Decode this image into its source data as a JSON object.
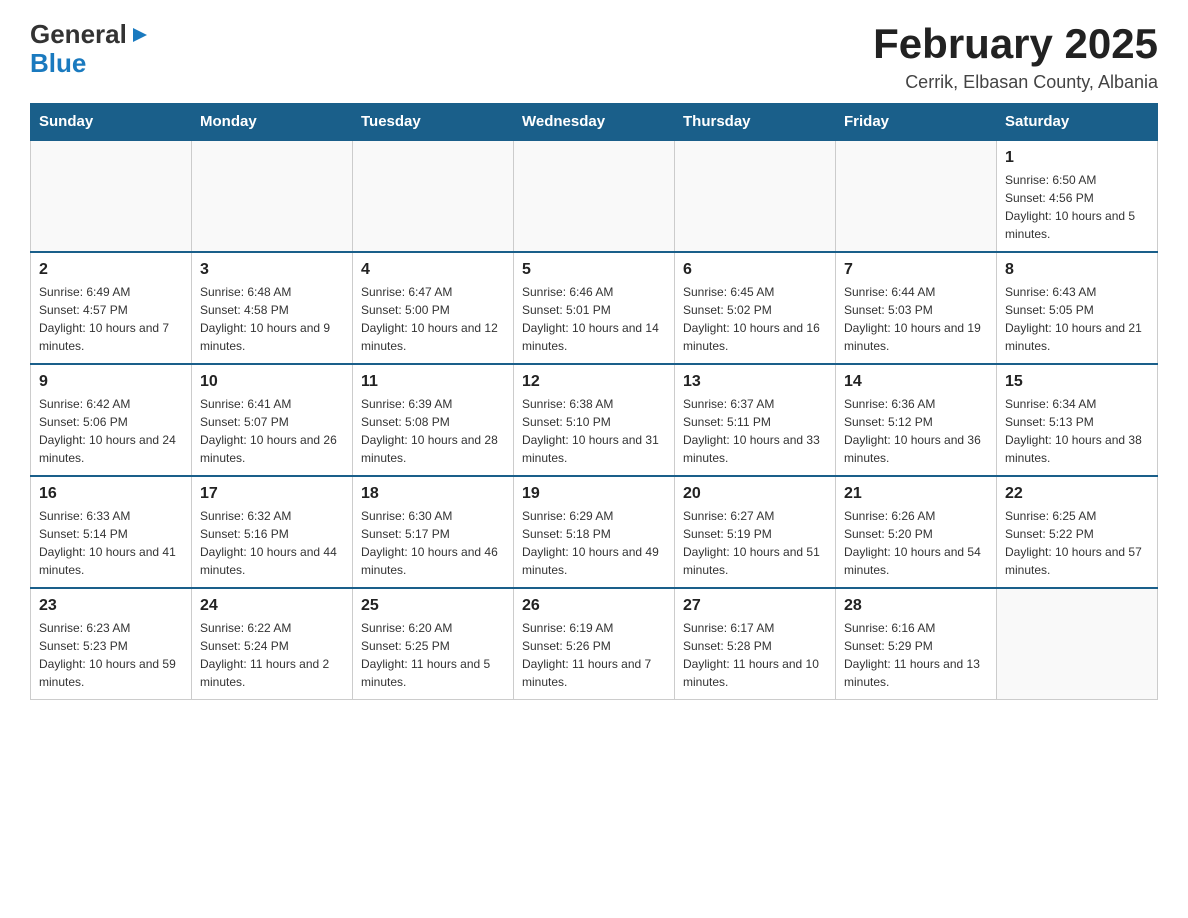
{
  "logo": {
    "general": "General",
    "blue": "Blue",
    "arrow": "▶"
  },
  "title": "February 2025",
  "subtitle": "Cerrik, Elbasan County, Albania",
  "days_of_week": [
    "Sunday",
    "Monday",
    "Tuesday",
    "Wednesday",
    "Thursday",
    "Friday",
    "Saturday"
  ],
  "weeks": [
    [
      {
        "day": "",
        "info": ""
      },
      {
        "day": "",
        "info": ""
      },
      {
        "day": "",
        "info": ""
      },
      {
        "day": "",
        "info": ""
      },
      {
        "day": "",
        "info": ""
      },
      {
        "day": "",
        "info": ""
      },
      {
        "day": "1",
        "info": "Sunrise: 6:50 AM\nSunset: 4:56 PM\nDaylight: 10 hours and 5 minutes."
      }
    ],
    [
      {
        "day": "2",
        "info": "Sunrise: 6:49 AM\nSunset: 4:57 PM\nDaylight: 10 hours and 7 minutes."
      },
      {
        "day": "3",
        "info": "Sunrise: 6:48 AM\nSunset: 4:58 PM\nDaylight: 10 hours and 9 minutes."
      },
      {
        "day": "4",
        "info": "Sunrise: 6:47 AM\nSunset: 5:00 PM\nDaylight: 10 hours and 12 minutes."
      },
      {
        "day": "5",
        "info": "Sunrise: 6:46 AM\nSunset: 5:01 PM\nDaylight: 10 hours and 14 minutes."
      },
      {
        "day": "6",
        "info": "Sunrise: 6:45 AM\nSunset: 5:02 PM\nDaylight: 10 hours and 16 minutes."
      },
      {
        "day": "7",
        "info": "Sunrise: 6:44 AM\nSunset: 5:03 PM\nDaylight: 10 hours and 19 minutes."
      },
      {
        "day": "8",
        "info": "Sunrise: 6:43 AM\nSunset: 5:05 PM\nDaylight: 10 hours and 21 minutes."
      }
    ],
    [
      {
        "day": "9",
        "info": "Sunrise: 6:42 AM\nSunset: 5:06 PM\nDaylight: 10 hours and 24 minutes."
      },
      {
        "day": "10",
        "info": "Sunrise: 6:41 AM\nSunset: 5:07 PM\nDaylight: 10 hours and 26 minutes."
      },
      {
        "day": "11",
        "info": "Sunrise: 6:39 AM\nSunset: 5:08 PM\nDaylight: 10 hours and 28 minutes."
      },
      {
        "day": "12",
        "info": "Sunrise: 6:38 AM\nSunset: 5:10 PM\nDaylight: 10 hours and 31 minutes."
      },
      {
        "day": "13",
        "info": "Sunrise: 6:37 AM\nSunset: 5:11 PM\nDaylight: 10 hours and 33 minutes."
      },
      {
        "day": "14",
        "info": "Sunrise: 6:36 AM\nSunset: 5:12 PM\nDaylight: 10 hours and 36 minutes."
      },
      {
        "day": "15",
        "info": "Sunrise: 6:34 AM\nSunset: 5:13 PM\nDaylight: 10 hours and 38 minutes."
      }
    ],
    [
      {
        "day": "16",
        "info": "Sunrise: 6:33 AM\nSunset: 5:14 PM\nDaylight: 10 hours and 41 minutes."
      },
      {
        "day": "17",
        "info": "Sunrise: 6:32 AM\nSunset: 5:16 PM\nDaylight: 10 hours and 44 minutes."
      },
      {
        "day": "18",
        "info": "Sunrise: 6:30 AM\nSunset: 5:17 PM\nDaylight: 10 hours and 46 minutes."
      },
      {
        "day": "19",
        "info": "Sunrise: 6:29 AM\nSunset: 5:18 PM\nDaylight: 10 hours and 49 minutes."
      },
      {
        "day": "20",
        "info": "Sunrise: 6:27 AM\nSunset: 5:19 PM\nDaylight: 10 hours and 51 minutes."
      },
      {
        "day": "21",
        "info": "Sunrise: 6:26 AM\nSunset: 5:20 PM\nDaylight: 10 hours and 54 minutes."
      },
      {
        "day": "22",
        "info": "Sunrise: 6:25 AM\nSunset: 5:22 PM\nDaylight: 10 hours and 57 minutes."
      }
    ],
    [
      {
        "day": "23",
        "info": "Sunrise: 6:23 AM\nSunset: 5:23 PM\nDaylight: 10 hours and 59 minutes."
      },
      {
        "day": "24",
        "info": "Sunrise: 6:22 AM\nSunset: 5:24 PM\nDaylight: 11 hours and 2 minutes."
      },
      {
        "day": "25",
        "info": "Sunrise: 6:20 AM\nSunset: 5:25 PM\nDaylight: 11 hours and 5 minutes."
      },
      {
        "day": "26",
        "info": "Sunrise: 6:19 AM\nSunset: 5:26 PM\nDaylight: 11 hours and 7 minutes."
      },
      {
        "day": "27",
        "info": "Sunrise: 6:17 AM\nSunset: 5:28 PM\nDaylight: 11 hours and 10 minutes."
      },
      {
        "day": "28",
        "info": "Sunrise: 6:16 AM\nSunset: 5:29 PM\nDaylight: 11 hours and 13 minutes."
      },
      {
        "day": "",
        "info": ""
      }
    ]
  ]
}
